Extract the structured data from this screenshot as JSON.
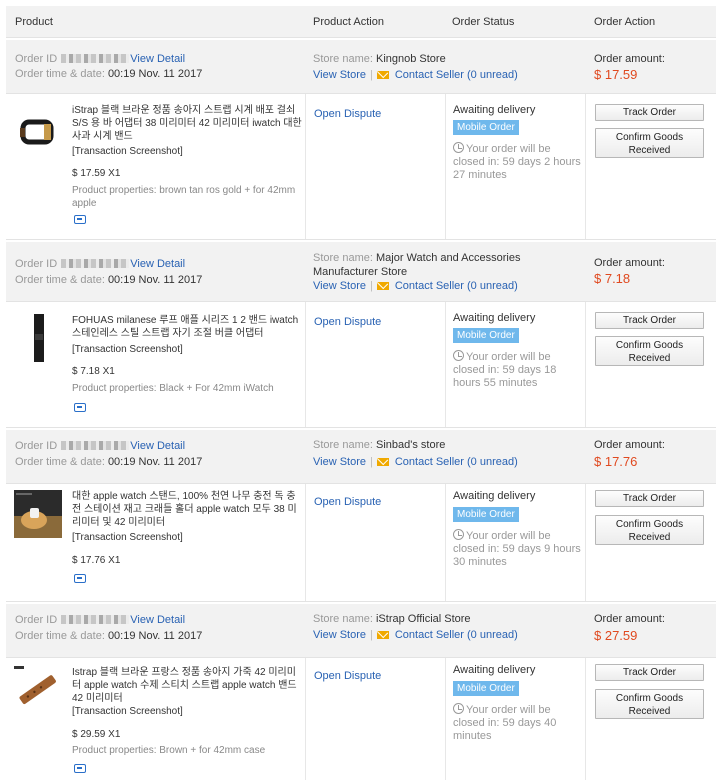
{
  "headers": {
    "product": "Product",
    "product_action": "Product Action",
    "order_status": "Order Status",
    "order_action": "Order Action"
  },
  "labels": {
    "order_id": "Order ID",
    "order_time": "Order time & date:",
    "view_detail": "View Detail",
    "store_name": "Store name:",
    "view_store": "View Store",
    "contact_seller": "Contact Seller",
    "order_amount": "Order amount:",
    "open_dispute": "Open Dispute",
    "transaction_screenshot": "[Transaction Screenshot]",
    "mobile_order": "Mobile Order",
    "track_order": "Track Order",
    "confirm_goods": "Confirm Goods Received"
  },
  "orders": [
    {
      "time": "00:19 Nov. 11 2017",
      "store": "Kingnob Store",
      "unread": "(0 unread)",
      "amount": "$ 17.59",
      "product": "iStrap 블랙 브라운 정품 송아지 스트랩 시계 배포 걸쇠 S/S 용 바 어댑터 38 미리미터 42 미리미터 iwatch 대한 사과 시계 밴드",
      "price": "$ 17.59 X1",
      "props": "Product properties: brown tan ros gold + for 42mm apple",
      "status": "Awaiting delivery",
      "countdown": "Your order will be closed in: 59 days 2 hours 27 minutes"
    },
    {
      "time": "00:19 Nov. 11 2017",
      "store": "Major Watch and Accessories Manufacturer Store",
      "unread": "(0 unread)",
      "amount": "$ 7.18",
      "product": "FOHUAS milanese 루프 애플 시리즈 1 2 밴드 iwatch 스테인레스 스틸 스트랩 자기 조절 버클 어댑터",
      "price": "$ 7.18 X1",
      "props": "Product properties: Black + For 42mm iWatch",
      "status": "Awaiting delivery",
      "countdown": "Your order will be closed in: 59 days 18 hours 55 minutes"
    },
    {
      "time": "00:19 Nov. 11 2017",
      "store": "Sinbad's store",
      "unread": "(0 unread)",
      "amount": "$ 17.76",
      "product": "대한 apple watch 스탠드, 100% 천연 나무 충전 독 충전 스테이션 재고 크래들 홀더 apple watch 모두 38 미리미터 및 42 미리미터",
      "price": "$ 17.76 X1",
      "props": "",
      "status": "Awaiting delivery",
      "countdown": "Your order will be closed in: 59 days 9 hours 30 minutes"
    },
    {
      "time": "00:19 Nov. 11 2017",
      "store": "iStrap Official Store",
      "unread": "(0 unread)",
      "amount": "$ 27.59",
      "product": "Istrap 블랙 브라운 프랑스 정품 송아지 가죽 42 미리미터 apple watch 수제 스티치 스트랩 apple watch 밴드 42 미리미터",
      "price": "$ 29.59 X1",
      "props": "Product properties: Brown + for 42mm case",
      "status": "Awaiting delivery",
      "countdown": "Your order will be closed in: 59 days 40 minutes"
    }
  ],
  "colors": {
    "link": "#2962b3",
    "amount": "#e0491f",
    "badge": "#6fb8ec",
    "header_bg": "#f2f2f2"
  },
  "icons": [
    "mail-icon",
    "clock-icon",
    "app-icon",
    "watch-band-thumbnail",
    "watch-stand-thumbnail"
  ]
}
